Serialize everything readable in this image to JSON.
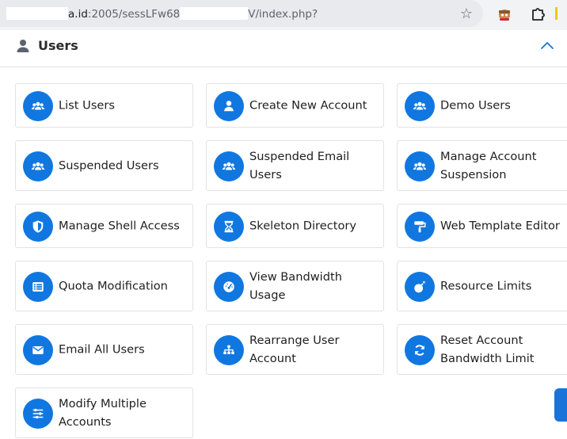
{
  "browser": {
    "url_host": "a.id",
    "url_port_path": ":2005/sessLFw68",
    "url_tail": "V/index.php?",
    "icons": [
      "star-icon",
      "extension-icon",
      "puzzle-icon"
    ]
  },
  "panel": {
    "title": "Users",
    "icon": "user-icon",
    "collapse_icon": "chevron-up-icon"
  },
  "tiles": [
    {
      "label": "List Users",
      "icon": "users-icon"
    },
    {
      "label": "Create New Account",
      "icon": "user-icon"
    },
    {
      "label": "Demo Users",
      "icon": "users-icon"
    },
    {
      "label": "Suspended Users",
      "icon": "users-icon"
    },
    {
      "label": "Suspended Email Users",
      "label1": "Suspended Email",
      "label2": "Users",
      "icon": "users-icon"
    },
    {
      "label": "Manage Account Suspension",
      "label1": "Manage Account",
      "label2": "Suspension",
      "icon": "users-icon"
    },
    {
      "label": "Manage Shell Access",
      "icon": "shield-icon"
    },
    {
      "label": "Skeleton Directory",
      "icon": "hourglass-icon"
    },
    {
      "label": "Web Template Editor",
      "icon": "paint-roller-icon"
    },
    {
      "label": "Quota Modification",
      "icon": "list-icon"
    },
    {
      "label": "View Bandwidth Usage",
      "label1": "View Bandwidth",
      "label2": "Usage",
      "icon": "gauge-icon"
    },
    {
      "label": "Resource Limits",
      "icon": "bomb-icon"
    },
    {
      "label": "Email All Users",
      "icon": "envelope-icon"
    },
    {
      "label": "Rearrange User Account",
      "label1": "Rearrange User",
      "label2": "Account",
      "icon": "sitemap-icon"
    },
    {
      "label": "Reset Account Bandwidth Limit",
      "label1": "Reset Account",
      "label2": "Bandwidth Limit",
      "icon": "sync-icon"
    },
    {
      "label": "Modify Multiple Accounts",
      "label1": "Modify Multiple",
      "label2": "Accounts",
      "icon": "sliders-icon"
    }
  ],
  "colors": {
    "accent": "#1177e0",
    "tile_border": "#e2e2e2",
    "chrome_bg": "#f1f3f4"
  }
}
